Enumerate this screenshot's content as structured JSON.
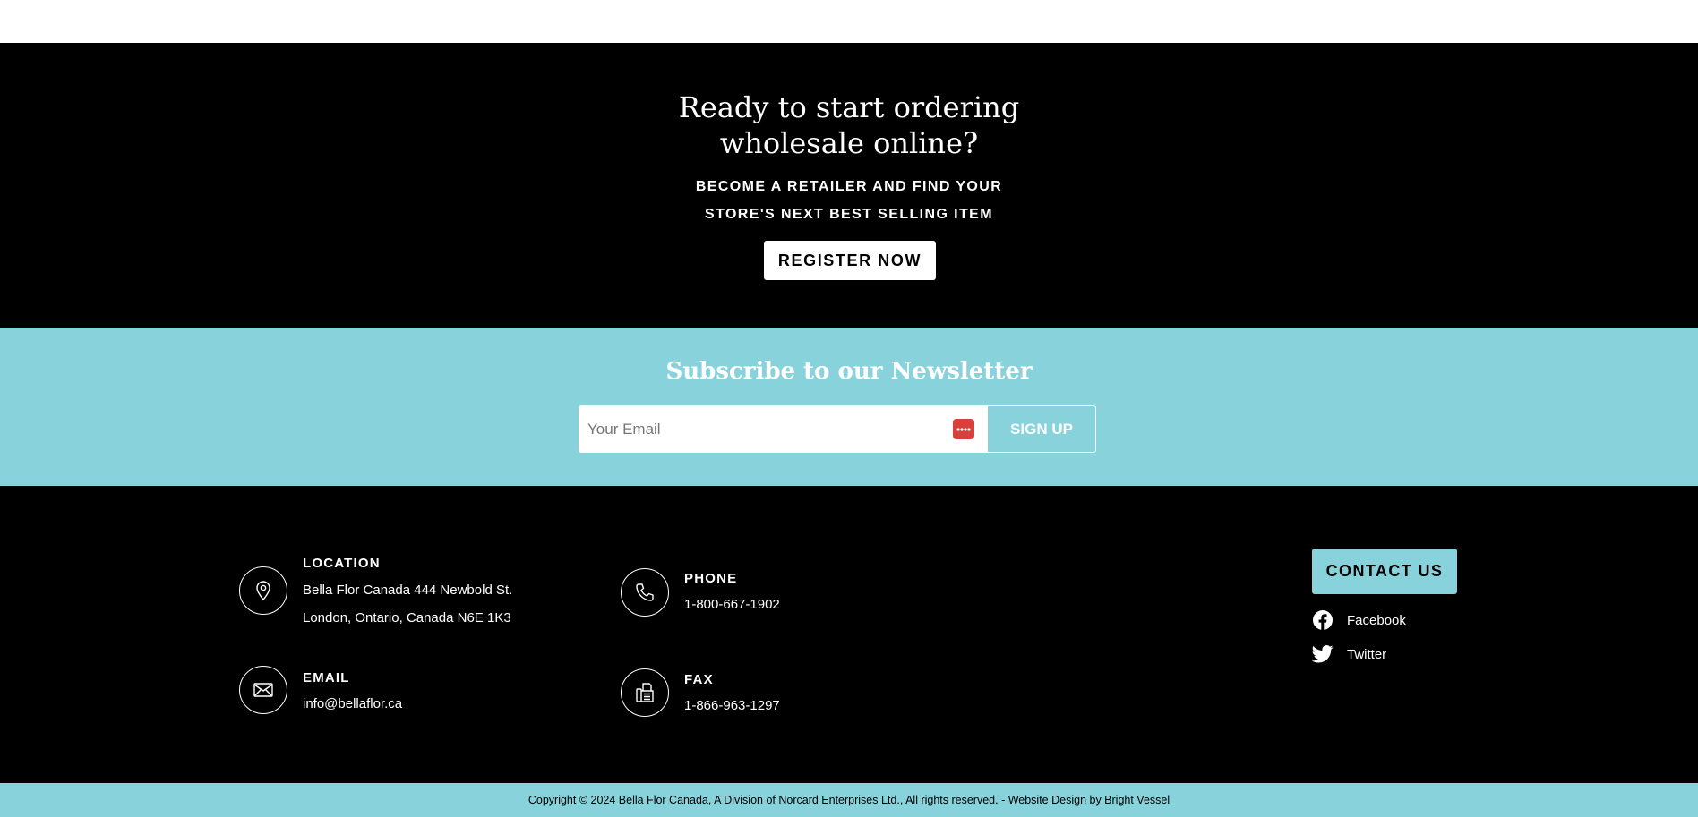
{
  "cta": {
    "title": "Ready to start ordering wholesale online?",
    "subtitle": "BECOME A RETAILER AND FIND YOUR STORE'S NEXT BEST SELLING ITEM",
    "button_label": "REGISTER NOW"
  },
  "newsletter": {
    "title": "Subscribe to our Newsletter",
    "email_placeholder": "Your Email",
    "signup_label": "SIGN UP"
  },
  "footer": {
    "location": {
      "heading": "LOCATION",
      "line1": "Bella Flor Canada 444 Newbold St.",
      "line2": "London, Ontario, Canada N6E 1K3",
      "icon": "map-pin-icon"
    },
    "phone": {
      "heading": "PHONE",
      "value": "1-800-667-1902",
      "icon": "phone-icon"
    },
    "email": {
      "heading": "EMAIL",
      "value": "info@bellaflor.ca",
      "icon": "envelope-icon"
    },
    "fax": {
      "heading": "FAX",
      "value": "1-866-963-1297",
      "icon": "fax-icon"
    },
    "contact_button": "CONTACT US",
    "social": [
      {
        "label": "Facebook",
        "icon": "facebook-icon"
      },
      {
        "label": "Twitter",
        "icon": "twitter-icon"
      }
    ]
  },
  "copyright": "Copyright © 2024 Bella Flor Canada, A Division of Norcard Enterprises Ltd., All rights reserved. - Website Design by Bright Vessel",
  "colors": {
    "accent": "#88d3db",
    "background_dark": "#000000",
    "text_light": "#ffffff",
    "password_icon": "#d9403a"
  }
}
